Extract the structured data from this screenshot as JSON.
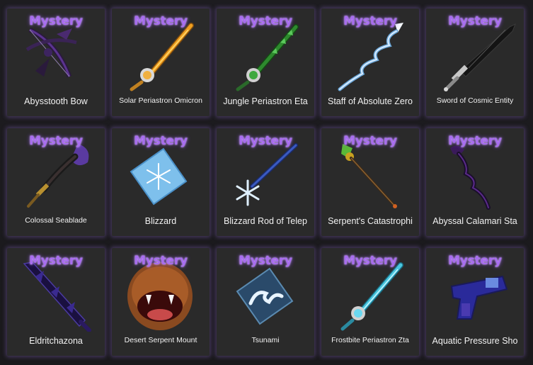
{
  "items": [
    {
      "tag": "Mystery",
      "name": "Abysstooth Bow",
      "icon": "dark-bow-icon",
      "size": "lg"
    },
    {
      "tag": "Mystery",
      "name": "Solar Periastron Omicron",
      "icon": "golden-sword-icon",
      "size": "sm"
    },
    {
      "tag": "Mystery",
      "name": "Jungle Periastron Eta",
      "icon": "green-sword-icon",
      "size": "lg"
    },
    {
      "tag": "Mystery",
      "name": "Staff of Absolute Zero",
      "icon": "ice-staff-icon",
      "size": "lg"
    },
    {
      "tag": "Mystery",
      "name": "Sword of Cosmic Entity",
      "icon": "black-sword-icon",
      "size": "sm"
    },
    {
      "tag": "Mystery",
      "name": "Colossal Seablade",
      "icon": "seablade-icon",
      "size": "sm"
    },
    {
      "tag": "Mystery",
      "name": "Blizzard",
      "icon": "snowflake-card-icon",
      "size": "lg"
    },
    {
      "tag": "Mystery",
      "name": "Blizzard Rod of Telep",
      "icon": "snowflake-rod-icon",
      "size": "lg"
    },
    {
      "tag": "Mystery",
      "name": "Serpent's Catastrophi",
      "icon": "serpent-spear-icon",
      "size": "lg"
    },
    {
      "tag": "Mystery",
      "name": "Abyssal Calamari Sta",
      "icon": "dark-staff-icon",
      "size": "lg"
    },
    {
      "tag": "Mystery",
      "name": "Eldritchazona",
      "icon": "purple-sword-icon",
      "size": "lg"
    },
    {
      "tag": "Mystery",
      "name": "Desert Serpent Mount",
      "icon": "serpent-mask-icon",
      "size": "sm"
    },
    {
      "tag": "Mystery",
      "name": "Tsunami",
      "icon": "wave-card-icon",
      "size": "sm"
    },
    {
      "tag": "Mystery",
      "name": "Frostbite Periastron Zta",
      "icon": "frost-sword-icon",
      "size": "sm"
    },
    {
      "tag": "Mystery",
      "name": "Aquatic Pressure Sho",
      "icon": "blue-blaster-icon",
      "size": "lg"
    }
  ]
}
